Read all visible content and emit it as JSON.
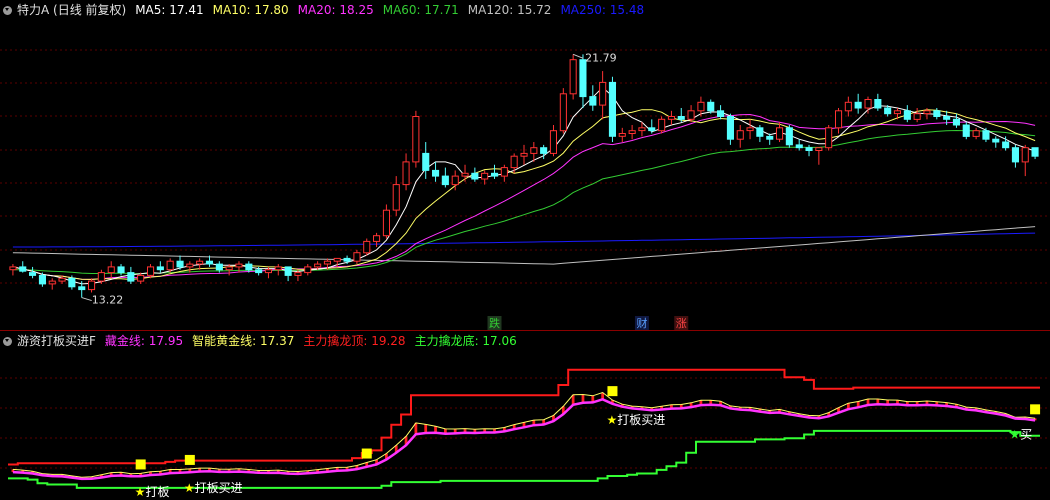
{
  "colors": {
    "up": "#ff3232",
    "down": "#54ffff",
    "ma5": "#ffffff",
    "ma10": "#ffff66",
    "ma20": "#ff33ff",
    "ma60": "#33cc33",
    "ma120": "#c0c0c0",
    "ma250": "#1a1aff",
    "grid": "#7a0000"
  },
  "top_legend": {
    "icon": "chevron-down-icon",
    "title": "特力A (日线 前复权)",
    "items": [
      {
        "key": "ma5",
        "text": "MA5: 17.41",
        "color": "#ffffff"
      },
      {
        "key": "ma10",
        "text": "MA10: 17.80",
        "color": "#ffff66"
      },
      {
        "key": "ma20",
        "text": "MA20: 18.25",
        "color": "#ff33ff"
      },
      {
        "key": "ma60",
        "text": "MA60: 17.71",
        "color": "#33cc33"
      },
      {
        "key": "ma120",
        "text": "MA120: 15.72",
        "color": "#c0c0c0"
      },
      {
        "key": "ma250",
        "text": "MA250: 15.48",
        "color": "#1a1aff"
      }
    ]
  },
  "bottom_legend": {
    "icon": "chevron-down-icon",
    "title": "游资打板买进F",
    "items": [
      {
        "key": "cang",
        "text": "藏金线: 17.95",
        "color": "#ff33ff"
      },
      {
        "key": "zhin",
        "text": "智能黄金线: 17.37",
        "color": "#ffff66"
      },
      {
        "key": "ding",
        "text": "主力擒龙顶: 19.28",
        "color": "#ff2020"
      },
      {
        "key": "di",
        "text": "主力擒龙底: 17.06",
        "color": "#33ff33"
      }
    ]
  },
  "chart_data": {
    "type": "candlestick",
    "price_range": [
      12.5,
      23.0
    ],
    "high_label": "21.79",
    "low_label": "13.22",
    "candles": [
      [
        14.2,
        14.4,
        14.0,
        14.3
      ],
      [
        14.3,
        14.5,
        14.1,
        14.15
      ],
      [
        14.1,
        14.3,
        13.9,
        14.0
      ],
      [
        14.0,
        14.1,
        13.6,
        13.7
      ],
      [
        13.7,
        13.9,
        13.5,
        13.8
      ],
      [
        13.8,
        14.0,
        13.7,
        13.9
      ],
      [
        13.9,
        14.0,
        13.5,
        13.6
      ],
      [
        13.6,
        13.8,
        13.22,
        13.5
      ],
      [
        13.5,
        13.9,
        13.4,
        13.8
      ],
      [
        13.8,
        14.2,
        13.7,
        14.1
      ],
      [
        14.1,
        14.5,
        13.9,
        14.3
      ],
      [
        14.3,
        14.4,
        14.0,
        14.1
      ],
      [
        14.1,
        14.3,
        13.7,
        13.8
      ],
      [
        13.8,
        14.1,
        13.7,
        14.0
      ],
      [
        14.0,
        14.4,
        13.9,
        14.3
      ],
      [
        14.3,
        14.5,
        14.1,
        14.2
      ],
      [
        14.2,
        14.6,
        14.1,
        14.5
      ],
      [
        14.5,
        14.7,
        14.2,
        14.3
      ],
      [
        14.3,
        14.5,
        14.1,
        14.4
      ],
      [
        14.4,
        14.6,
        14.2,
        14.5
      ],
      [
        14.5,
        14.7,
        14.3,
        14.4
      ],
      [
        14.4,
        14.5,
        14.1,
        14.2
      ],
      [
        14.2,
        14.4,
        14.0,
        14.3
      ],
      [
        14.3,
        14.5,
        14.1,
        14.4
      ],
      [
        14.4,
        14.5,
        14.1,
        14.2
      ],
      [
        14.2,
        14.3,
        14.0,
        14.1
      ],
      [
        14.1,
        14.3,
        13.9,
        14.2
      ],
      [
        14.2,
        14.4,
        14.0,
        14.3
      ],
      [
        14.3,
        14.3,
        13.8,
        14.0
      ],
      [
        14.0,
        14.2,
        13.8,
        14.1
      ],
      [
        14.1,
        14.4,
        14.0,
        14.3
      ],
      [
        14.3,
        14.5,
        14.2,
        14.4
      ],
      [
        14.4,
        14.6,
        14.2,
        14.5
      ],
      [
        14.5,
        14.6,
        14.3,
        14.6
      ],
      [
        14.6,
        14.7,
        14.4,
        14.5
      ],
      [
        14.5,
        14.9,
        14.4,
        14.8
      ],
      [
        14.8,
        15.3,
        14.7,
        15.2
      ],
      [
        15.2,
        15.5,
        15.0,
        15.4
      ],
      [
        15.4,
        16.5,
        15.3,
        16.3
      ],
      [
        16.3,
        17.5,
        16.1,
        17.2
      ],
      [
        17.2,
        18.3,
        17.0,
        18.0
      ],
      [
        18.0,
        19.8,
        17.8,
        19.6
      ],
      [
        18.3,
        18.7,
        17.4,
        17.7
      ],
      [
        17.7,
        18.0,
        17.3,
        17.5
      ],
      [
        17.5,
        17.8,
        17.1,
        17.2
      ],
      [
        17.2,
        17.7,
        17.0,
        17.5
      ],
      [
        17.5,
        17.9,
        17.3,
        17.6
      ],
      [
        17.6,
        17.8,
        17.3,
        17.4
      ],
      [
        17.4,
        17.7,
        17.2,
        17.6
      ],
      [
        17.6,
        17.9,
        17.4,
        17.5
      ],
      [
        17.5,
        17.9,
        17.3,
        17.8
      ],
      [
        17.8,
        18.3,
        17.6,
        18.2
      ],
      [
        18.2,
        18.6,
        17.9,
        18.3
      ],
      [
        18.3,
        18.7,
        18.0,
        18.5
      ],
      [
        18.5,
        18.6,
        18.1,
        18.3
      ],
      [
        18.3,
        19.3,
        18.2,
        19.1
      ],
      [
        19.1,
        20.6,
        19.0,
        20.4
      ],
      [
        20.4,
        21.79,
        20.2,
        21.6
      ],
      [
        21.6,
        21.79,
        19.9,
        20.3
      ],
      [
        20.3,
        20.7,
        19.8,
        20.0
      ],
      [
        20.0,
        21.2,
        19.5,
        20.8
      ],
      [
        20.8,
        21.0,
        18.7,
        18.9
      ],
      [
        18.9,
        19.2,
        18.7,
        19.0
      ],
      [
        19.0,
        19.3,
        18.8,
        19.1
      ],
      [
        19.1,
        19.4,
        18.9,
        19.2
      ],
      [
        19.2,
        19.5,
        19.0,
        19.1
      ],
      [
        19.1,
        19.6,
        19.0,
        19.5
      ],
      [
        19.5,
        19.8,
        19.3,
        19.6
      ],
      [
        19.6,
        19.9,
        19.4,
        19.5
      ],
      [
        19.5,
        20.0,
        19.4,
        19.8
      ],
      [
        19.8,
        20.3,
        19.6,
        20.1
      ],
      [
        20.1,
        20.2,
        19.7,
        19.8
      ],
      [
        19.8,
        20.0,
        19.5,
        19.6
      ],
      [
        19.6,
        19.7,
        18.6,
        18.8
      ],
      [
        18.8,
        19.3,
        18.5,
        19.1
      ],
      [
        19.1,
        19.5,
        18.8,
        19.2
      ],
      [
        19.2,
        19.3,
        18.7,
        18.9
      ],
      [
        18.9,
        19.0,
        18.6,
        18.8
      ],
      [
        18.8,
        19.4,
        18.7,
        19.2
      ],
      [
        19.2,
        19.3,
        18.5,
        18.6
      ],
      [
        18.6,
        18.8,
        18.4,
        18.5
      ],
      [
        18.5,
        18.6,
        18.2,
        18.4
      ],
      [
        18.4,
        18.5,
        17.9,
        18.5
      ],
      [
        18.5,
        19.3,
        18.4,
        19.2
      ],
      [
        19.2,
        19.9,
        19.0,
        19.8
      ],
      [
        19.8,
        20.3,
        19.6,
        20.1
      ],
      [
        20.1,
        20.4,
        19.7,
        19.9
      ],
      [
        19.9,
        20.3,
        19.7,
        20.2
      ],
      [
        20.2,
        20.4,
        19.8,
        19.9
      ],
      [
        19.9,
        20.0,
        19.6,
        19.7
      ],
      [
        19.7,
        19.9,
        19.5,
        19.8
      ],
      [
        19.8,
        20.0,
        19.4,
        19.5
      ],
      [
        19.5,
        19.9,
        19.4,
        19.7
      ],
      [
        19.7,
        19.9,
        19.5,
        19.8
      ],
      [
        19.8,
        19.9,
        19.5,
        19.6
      ],
      [
        19.6,
        19.8,
        19.3,
        19.5
      ],
      [
        19.5,
        19.7,
        19.2,
        19.3
      ],
      [
        19.3,
        19.4,
        18.8,
        18.9
      ],
      [
        18.9,
        19.2,
        18.8,
        19.1
      ],
      [
        19.1,
        19.2,
        18.7,
        18.8
      ],
      [
        18.8,
        18.9,
        18.5,
        18.7
      ],
      [
        18.7,
        18.9,
        18.4,
        18.5
      ],
      [
        18.5,
        18.6,
        17.8,
        18.0
      ],
      [
        18.0,
        18.6,
        17.5,
        18.5
      ],
      [
        18.5,
        18.5,
        18.1,
        18.2
      ]
    ],
    "markers": [
      {
        "text": "跌",
        "index": 49,
        "color": "#33cc33",
        "bg": "#203820"
      },
      {
        "text": "财",
        "index": 64,
        "color": "#5aa0ff",
        "bg": "#101840"
      },
      {
        "text": "涨",
        "index": 68,
        "color": "#ff4444",
        "bg": "#401010"
      }
    ],
    "signals": [
      {
        "text": "★打板",
        "index": 13
      },
      {
        "text": "★打板买进",
        "index": 18
      },
      {
        "text": "★打板买进",
        "index": 61
      },
      {
        "text": "★买",
        "index": 102,
        "star_color": "#33ff33"
      },
      {
        "text": "★打板买进",
        "index": 105
      }
    ],
    "yellow_blocks": [
      13,
      18,
      36,
      61,
      104
    ]
  }
}
